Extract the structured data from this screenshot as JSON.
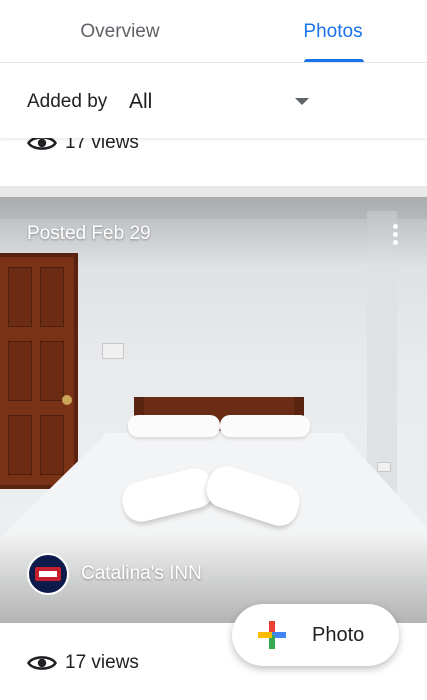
{
  "tabs": [
    {
      "label": "Overview",
      "active": false
    },
    {
      "label": "Photos",
      "active": true
    }
  ],
  "filter": {
    "label": "Added by",
    "value": "All"
  },
  "prev_card": {
    "views_text": "17 views"
  },
  "card": {
    "posted": "Posted Feb 29",
    "author": "Catalina's INN",
    "views_text": "17 views"
  },
  "fab": {
    "label": "Photo"
  },
  "colors": {
    "accent": "#1a73e8",
    "text": "#202124",
    "muted": "#5f6368",
    "divider": "#e8e8e8"
  },
  "icons": {
    "views": "eye-icon",
    "more": "more-vert-icon",
    "filter": "dropdown-arrow-icon",
    "fab": "google-plus-icon"
  }
}
